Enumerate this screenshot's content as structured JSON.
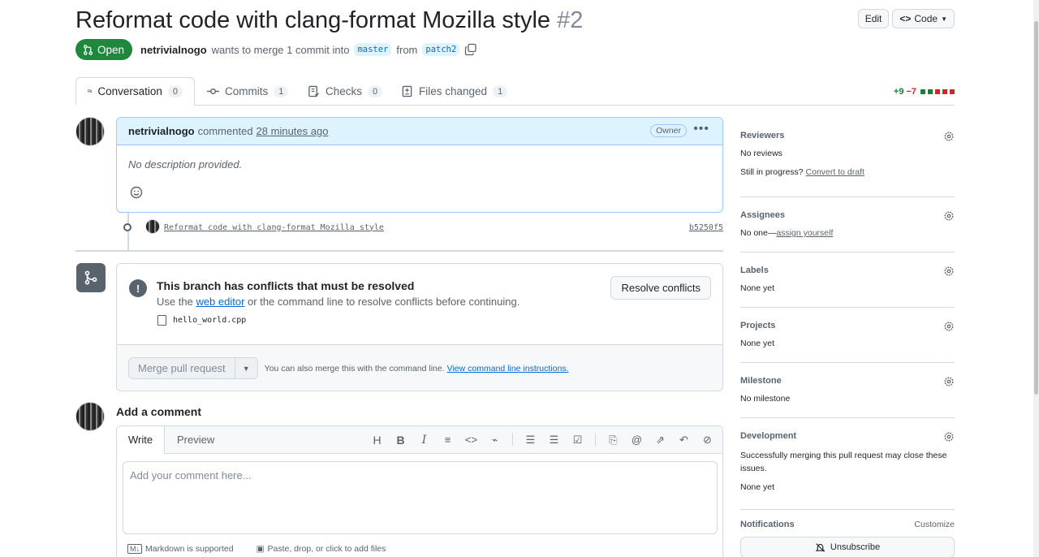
{
  "pr": {
    "title": "Reformat code with clang-format Mozilla style",
    "number": "#2",
    "state": "Open",
    "author": "netrivialnogo",
    "merge_text": "wants to merge 1 commit into",
    "base_branch": "master",
    "from_text": "from",
    "head_branch": "patch2"
  },
  "header": {
    "edit_label": "Edit",
    "code_label": "Code"
  },
  "tabs": [
    {
      "label": "Conversation",
      "count": "0"
    },
    {
      "label": "Commits",
      "count": "1"
    },
    {
      "label": "Checks",
      "count": "0"
    },
    {
      "label": "Files changed",
      "count": "1"
    }
  ],
  "diffstat": {
    "additions": "+9",
    "deletions": "−7"
  },
  "comment": {
    "author": "netrivialnogo",
    "action": "commented",
    "time": "28 minutes ago",
    "role_badge": "Owner",
    "body": "No description provided."
  },
  "commit": {
    "message": "Reformat code with clang-format Mozilla style",
    "sha": "b5250f5"
  },
  "merge": {
    "conflict_title": "This branch has conflicts that must be resolved",
    "desc_prefix": "Use the",
    "desc_link": "web editor",
    "desc_suffix": "or the command line to resolve conflicts before continuing.",
    "conflict_file": "hello_world.cpp",
    "resolve_label": "Resolve conflicts",
    "merge_button": "Merge pull request",
    "cmdline_text": "You can also merge this with the command line.",
    "cmdline_link": "View command line instructions."
  },
  "add_comment": {
    "title": "Add a comment",
    "write_tab": "Write",
    "preview_tab": "Preview",
    "placeholder": "Add your comment here...",
    "markdown_note": "Markdown is supported",
    "attach_note": "Paste, drop, or click to add files"
  },
  "sidebar": {
    "reviewers": {
      "heading": "Reviewers",
      "value": "No reviews",
      "progress_text": "Still in progress?",
      "progress_link": "Convert to draft"
    },
    "assignees": {
      "heading": "Assignees",
      "value_prefix": "No one—",
      "value_link": "assign yourself"
    },
    "labels": {
      "heading": "Labels",
      "value": "None yet"
    },
    "projects": {
      "heading": "Projects",
      "value": "None yet"
    },
    "milestone": {
      "heading": "Milestone",
      "value": "No milestone"
    },
    "development": {
      "heading": "Development",
      "text": "Successfully merging this pull request may close these issues.",
      "value": "None yet"
    },
    "notifications": {
      "heading": "Notifications",
      "customize": "Customize",
      "unsubscribe": "Unsubscribe"
    }
  },
  "colors": {
    "open_green": "#1f883d",
    "link_blue": "#0969da",
    "comment_header": "#ddf4ff"
  }
}
